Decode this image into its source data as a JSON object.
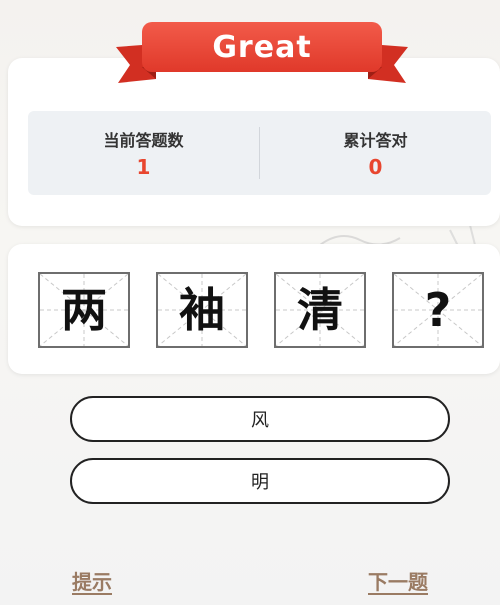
{
  "banner": {
    "title": "Great"
  },
  "stats": {
    "current": {
      "label": "当前答题数",
      "value": "1"
    },
    "total": {
      "label": "累计答对",
      "value": "0"
    }
  },
  "puzzle": {
    "tiles": [
      "两",
      "袖",
      "清",
      "?"
    ]
  },
  "options": [
    "风",
    "明"
  ],
  "footer": {
    "hint": "提示",
    "next": "下一题"
  },
  "colors": {
    "accent_red": "#e8462f",
    "link_brown": "#9a7b63",
    "ribbon_red": "#e0392a"
  }
}
